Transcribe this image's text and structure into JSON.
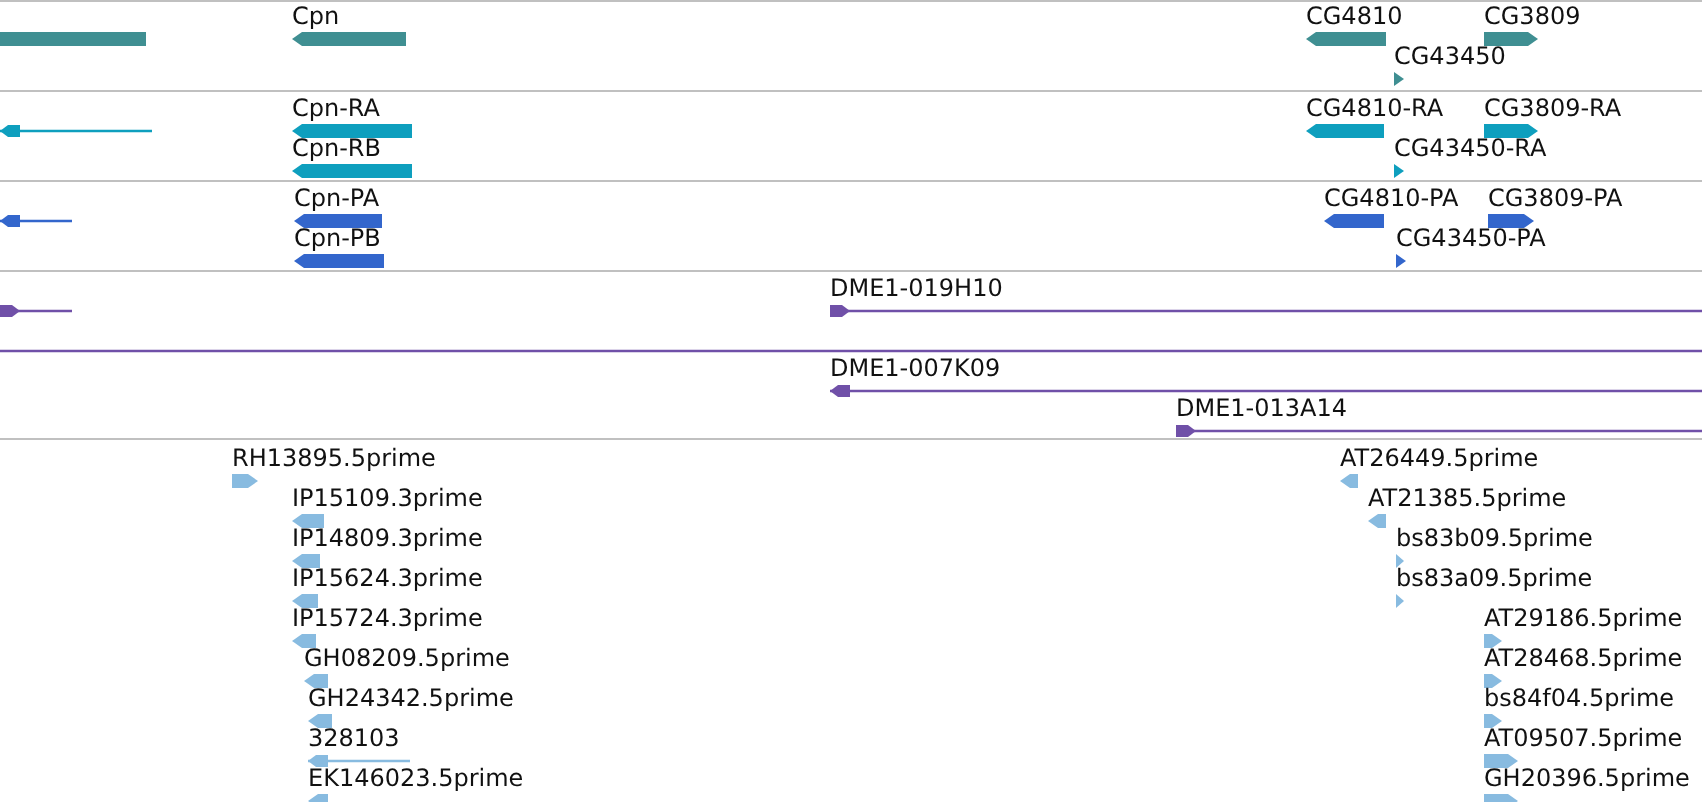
{
  "tracks": [
    {
      "kind": "gene",
      "color": "#3f8f92",
      "features": [
        {
          "kind": "block"
        },
        {
          "kind": "block",
          "forward": false,
          "label": "Cpn"
        },
        {
          "kind": "block",
          "forward": false,
          "label": "CG4810"
        },
        {
          "kind": "block",
          "forward": true,
          "label": "CG3809"
        },
        {
          "kind": "block",
          "forward": true,
          "label": "CG43450"
        }
      ]
    },
    {
      "kind": "transcript",
      "color": "#0e9fbe",
      "features": [
        {
          "kind": "line",
          "forward": false
        },
        {
          "kind": "block",
          "forward": false,
          "label": "Cpn-RA"
        },
        {
          "kind": "block",
          "forward": false,
          "label": "CG4810-RA"
        },
        {
          "kind": "block",
          "forward": true,
          "label": "CG3809-RA"
        },
        {
          "kind": "block",
          "forward": false,
          "label": "Cpn-RB"
        },
        {
          "kind": "block",
          "forward": true,
          "label": "CG43450-RA"
        }
      ]
    },
    {
      "kind": "protein",
      "color": "#3366cc",
      "features": [
        {
          "kind": "line",
          "forward": false
        },
        {
          "kind": "block",
          "forward": false,
          "label": "Cpn-PA"
        },
        {
          "kind": "block",
          "forward": false,
          "label": "CG4810-PA"
        },
        {
          "kind": "block",
          "forward": true,
          "label": "CG3809-PA"
        },
        {
          "kind": "block",
          "forward": false,
          "label": "Cpn-PB"
        },
        {
          "kind": "block",
          "forward": true,
          "label": "CG43450-PA"
        }
      ]
    },
    {
      "kind": "clone",
      "color": "#7050a8",
      "features": [
        {
          "kind": "line",
          "forward": true
        },
        {
          "kind": "line",
          "forward": true,
          "label": "DME1-019H10"
        },
        {
          "kind": "line"
        },
        {
          "kind": "line",
          "forward": false,
          "label": "DME1-007K09"
        },
        {
          "kind": "line",
          "forward": true,
          "label": "DME1-013A14"
        }
      ]
    },
    {
      "kind": "est",
      "color": "#88bbe0",
      "features": [
        {
          "kind": "block",
          "forward": true,
          "label": "RH13895.5prime"
        },
        {
          "kind": "block",
          "forward": false,
          "label": "AT26449.5prime"
        },
        {
          "kind": "block",
          "forward": false,
          "label": "IP15109.3prime"
        },
        {
          "kind": "block",
          "forward": false,
          "label": "AT21385.5prime"
        },
        {
          "kind": "block",
          "forward": false,
          "label": "IP14809.3prime"
        },
        {
          "kind": "block",
          "forward": true,
          "label": "bs83b09.5prime"
        },
        {
          "kind": "block",
          "forward": false,
          "label": "IP15624.3prime"
        },
        {
          "kind": "block",
          "forward": true,
          "label": "bs83a09.5prime"
        },
        {
          "kind": "block",
          "forward": false,
          "label": "IP15724.3prime"
        },
        {
          "kind": "block",
          "forward": true,
          "label": "AT29186.5prime"
        },
        {
          "kind": "block",
          "forward": false,
          "label": "GH08209.5prime"
        },
        {
          "kind": "block",
          "forward": true,
          "label": "AT28468.5prime"
        },
        {
          "kind": "block",
          "forward": false,
          "label": "GH24342.5prime"
        },
        {
          "kind": "block",
          "forward": true,
          "label": "bs84f04.5prime"
        },
        {
          "kind": "line",
          "forward": false,
          "label": "328103"
        },
        {
          "kind": "block",
          "forward": true,
          "label": "AT09507.5prime"
        },
        {
          "kind": "block",
          "forward": false,
          "label": "EK146023.5prime"
        },
        {
          "kind": "block",
          "forward": true,
          "label": "GH20396.5prime"
        }
      ]
    }
  ]
}
